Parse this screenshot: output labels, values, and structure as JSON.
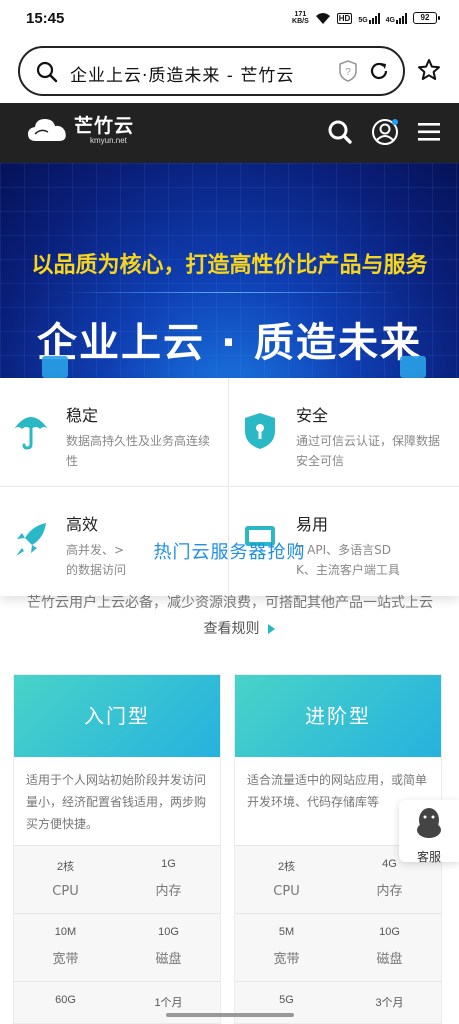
{
  "status_bar": {
    "time": "15:45",
    "net_speed_value": "171",
    "net_speed_unit": "KB/S",
    "hd": "HD",
    "sig1": "5G",
    "sig2": "4G",
    "battery": "92"
  },
  "browser": {
    "page_title": "企业上云·质造未来 - 芒竹云"
  },
  "site": {
    "logo_name": "芒竹云",
    "logo_domain": "kmyun.net"
  },
  "banner": {
    "slogan": "以品质为核心，打造高性价比产品与服务",
    "title": "企业上云 · 质造未来"
  },
  "features": [
    {
      "title": "稳定",
      "desc": "数据高持久性及业务高连续性",
      "icon": "umbrella-icon"
    },
    {
      "title": "安全",
      "desc": "通过可信云认证，保障数据安全可信",
      "icon": "shield-lock-icon"
    },
    {
      "title": "高效",
      "desc": "高并发、...的数据访问",
      "icon": "rocket-icon"
    },
    {
      "title": "易用",
      "desc": "...T API、多语言SDK、主流客户端工具",
      "icon": "devices-icon"
    }
  ],
  "feature_desc_visible": {
    "f3_line1": "高并发、>",
    "f3_line2": "的数据访问",
    "f4_line1": "T API、多语言SD",
    "f4_line2": "K、主流客户端工具"
  },
  "hot_section": {
    "title": "热门云服务器抢购"
  },
  "intro": {
    "text": "芒竹云用户上云必备，减少资源浪费，可搭配其他产品一站式上云",
    "link": "查看规则"
  },
  "products": [
    {
      "name": "入门型",
      "desc": "适用于个人网站初始阶段并发访问量小，经济配置省钱适用，两步购买方便快捷。",
      "specs": [
        {
          "value": "2核",
          "label": "CPU"
        },
        {
          "value": "1G",
          "label": "内存"
        },
        {
          "value": "10M",
          "label": "宽带"
        },
        {
          "value": "10G",
          "label": "磁盘"
        },
        {
          "value": "60G",
          "label": ""
        },
        {
          "value": "1个月",
          "label": ""
        }
      ]
    },
    {
      "name": "进阶型",
      "desc": "适合流量适中的网站应用，或简单开发环境、代码存储库等",
      "specs": [
        {
          "value": "2核",
          "label": "CPU"
        },
        {
          "value": "4G",
          "label": "内存"
        },
        {
          "value": "5M",
          "label": "宽带"
        },
        {
          "value": "10G",
          "label": "磁盘"
        },
        {
          "value": "5G",
          "label": ""
        },
        {
          "value": "3个月",
          "label": ""
        }
      ]
    }
  ],
  "customer_service": {
    "label": "客服"
  },
  "colors": {
    "accent": "#23b8c4",
    "header_bg": "#222222",
    "banner_yellow": "#f7d51d",
    "hot_blue": "#1e8fe6"
  }
}
